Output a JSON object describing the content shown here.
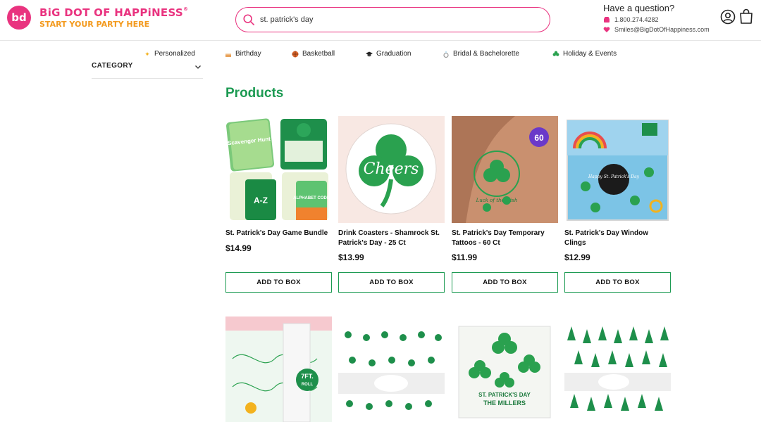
{
  "brand": {
    "logo_mark": "bd",
    "name": "BiG DOT OF HAPPiNESS",
    "registered": "®",
    "tagline": "START YOUR PARTY HERE"
  },
  "search": {
    "value": "st. patrick's day"
  },
  "contact": {
    "question": "Have a question?",
    "phone": "1.800.274.4282",
    "email": "Smiles@BigDotOfHappiness.com"
  },
  "nav": [
    {
      "label": "Personalized",
      "icon": "sparkle-icon"
    },
    {
      "label": "Birthday",
      "icon": "cake-icon"
    },
    {
      "label": "Basketball",
      "icon": "basketball-icon"
    },
    {
      "label": "Graduation",
      "icon": "grad-cap-icon"
    },
    {
      "label": "Bridal & Bachelorette",
      "icon": "ring-icon"
    },
    {
      "label": "Holiday & Events",
      "icon": "clover-icon"
    }
  ],
  "sidebar": {
    "category_label": "CATEGORY"
  },
  "products": {
    "title": "Products",
    "add_label": "ADD TO BOX",
    "items": [
      {
        "name_line1": "St. Patrick's Day Game Bundle",
        "name_line2": "",
        "price": "$14.99"
      },
      {
        "name_line1": "Drink Coasters - Shamrock St.",
        "name_line2": "Patrick's Day - 25 Ct",
        "price": "$13.99"
      },
      {
        "name_line1": "St. Patrick's Day Temporary",
        "name_line2": "Tattoos - 60 Ct",
        "price": "$11.99"
      },
      {
        "name_line1": "St. Patrick's Day Window",
        "name_line2": "Clings",
        "price": "$12.99"
      }
    ],
    "image_text": {
      "coaster": "Cheers",
      "tattoo_badge": "60",
      "tattoo_text": "Luck of the Irish",
      "roll_badge_top": "7FT.",
      "roll_badge_bottom": "ROLL",
      "napkin_line1": "ST. PATRICK'S DAY",
      "napkin_line2": "THE MILLERS",
      "game_card1": "Scavenger Hunt",
      "game_card2": "A-Z",
      "game_card3": "ALPHABET CODE",
      "cling_text": "Happy St. Patrick's Day"
    }
  },
  "colors": {
    "brand_pink": "#e9337f",
    "brand_orange": "#f39a1e",
    "accent_green": "#1c9a52"
  }
}
